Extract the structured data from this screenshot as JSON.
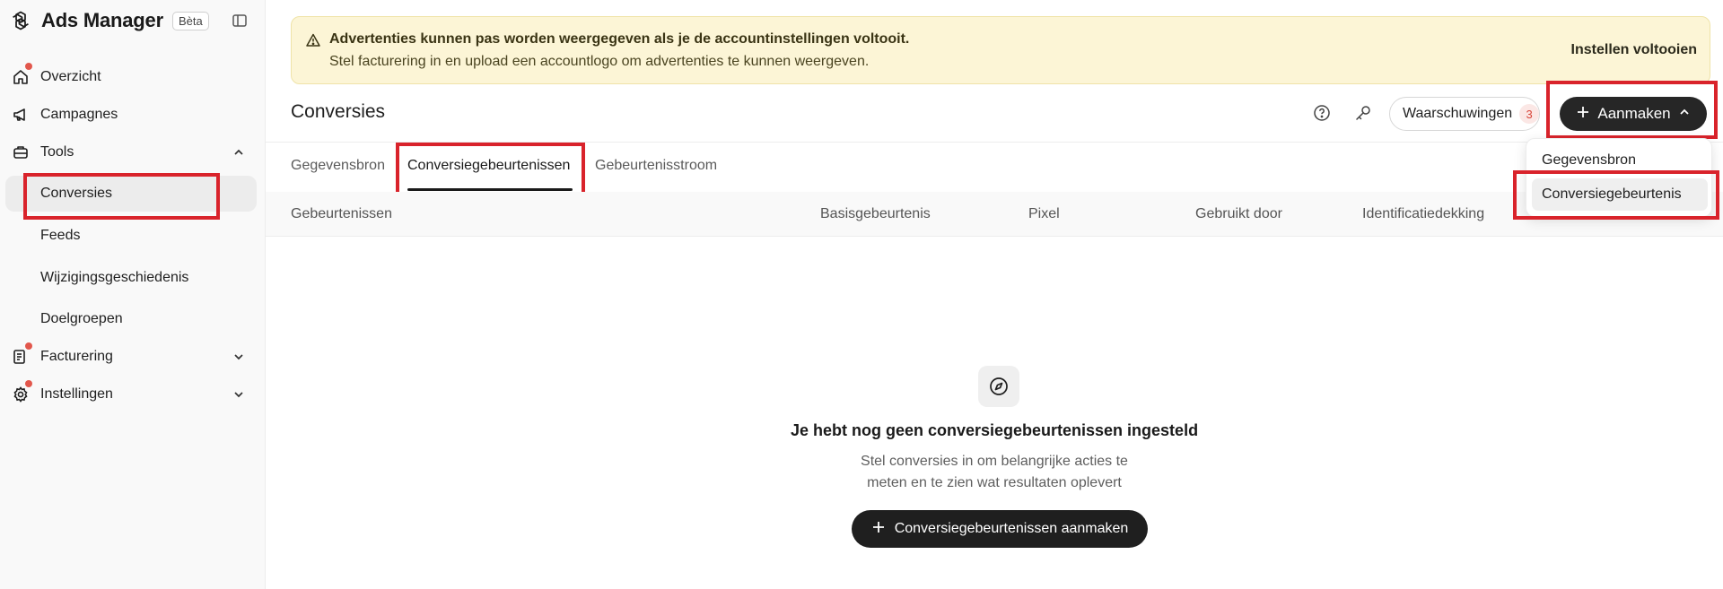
{
  "app": {
    "title": "Ads Manager",
    "badge": "Bèta"
  },
  "sidebar": {
    "items": [
      {
        "label": "Overzicht",
        "icon": "home-icon",
        "notify": true
      },
      {
        "label": "Campagnes",
        "icon": "megaphone-icon",
        "notify": false
      },
      {
        "label": "Tools",
        "icon": "toolbox-icon",
        "notify": false,
        "expanded": true
      },
      {
        "label": "Conversies",
        "active": true
      },
      {
        "label": "Feeds"
      },
      {
        "label": "Wijzigingsgeschiedenis"
      },
      {
        "label": "Doelgroepen"
      },
      {
        "label": "Facturering",
        "icon": "invoice-icon",
        "notify": true,
        "expanded": false
      },
      {
        "label": "Instellingen",
        "icon": "gear-icon",
        "notify": true,
        "expanded": false
      }
    ]
  },
  "banner": {
    "title": "Advertenties kunnen pas worden weergegeven als je de accountinstellingen voltooit.",
    "subtitle": "Stel facturering in en upload een accountlogo om advertenties te kunnen weergeven.",
    "action": "Instellen voltooien"
  },
  "header": {
    "title": "Conversies",
    "warnings_label": "Waarschuwingen",
    "warnings_count": "3",
    "create_label": "Aanmaken"
  },
  "tabs": [
    {
      "label": "Gegevensbron"
    },
    {
      "label": "Conversiegebeurtenissen",
      "active": true
    },
    {
      "label": "Gebeurtenisstroom"
    }
  ],
  "table": {
    "columns": [
      "Gebeurtenissen",
      "Basisgebeurtenis",
      "Pixel",
      "Gebruikt door",
      "Identificatiedekking"
    ]
  },
  "dropdown": {
    "items": [
      "Gegevensbron",
      "Conversiegebeurtenis"
    ]
  },
  "empty": {
    "title": "Je hebt nog geen conversiegebeurtenissen ingesteld",
    "line1": "Stel conversies in om belangrijke acties te",
    "line2": "meten en te zien wat resultaten oplevert",
    "cta": "Conversiegebeurtenissen aanmaken"
  }
}
